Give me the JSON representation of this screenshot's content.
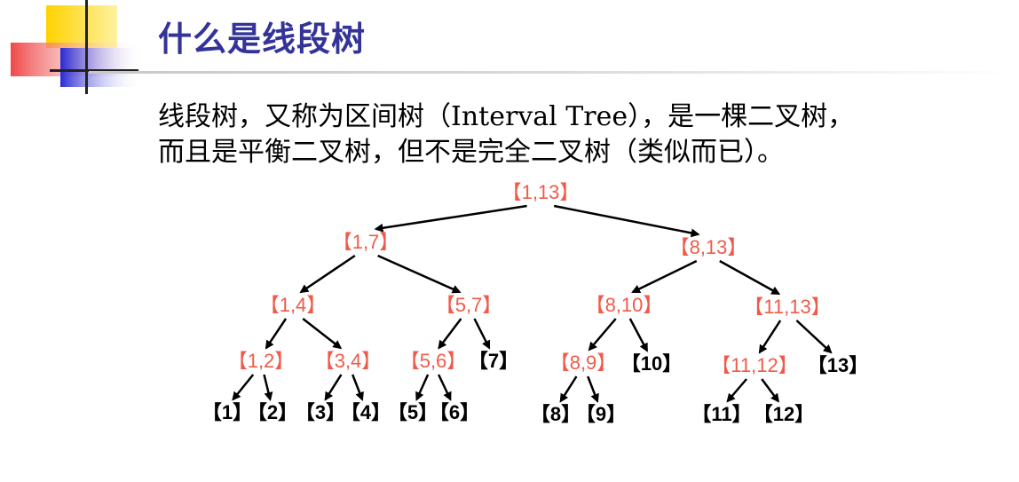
{
  "slide": {
    "title": "什么是线段树",
    "paragraph": [
      "线段树，又称为区间树（Interval Tree），是一棵二叉树，",
      "而且是平衡二叉树，但不是完全二叉树（类似而已）。"
    ]
  },
  "colors": {
    "title": "#333399",
    "internal_node": "#f05a4a",
    "leaf_node": "#000000",
    "edge": "#000000",
    "accent_yellow": "#ffd200",
    "accent_blue": "#2a2ad4",
    "accent_red": "#f04848"
  },
  "tree": {
    "nodes": [
      {
        "id": "n1_13",
        "label": "【1,13】",
        "type": "internal"
      },
      {
        "id": "n1_7",
        "label": "【1,7】",
        "type": "internal"
      },
      {
        "id": "n8_13",
        "label": "【8,13】",
        "type": "internal"
      },
      {
        "id": "n1_4",
        "label": "【1,4】",
        "type": "internal"
      },
      {
        "id": "n5_7",
        "label": "【5,7】",
        "type": "internal"
      },
      {
        "id": "n8_10",
        "label": "【8,10】",
        "type": "internal"
      },
      {
        "id": "n11_13",
        "label": "【11,13】",
        "type": "internal"
      },
      {
        "id": "n1_2",
        "label": "【1,2】",
        "type": "internal"
      },
      {
        "id": "n3_4",
        "label": "【3,4】",
        "type": "internal"
      },
      {
        "id": "n5_6",
        "label": "【5,6】",
        "type": "internal"
      },
      {
        "id": "n7",
        "label": "【7】",
        "type": "leaf"
      },
      {
        "id": "n8_9",
        "label": "【8,9】",
        "type": "internal"
      },
      {
        "id": "n10",
        "label": "【10】",
        "type": "leaf"
      },
      {
        "id": "n11_12",
        "label": "【11,12】",
        "type": "internal"
      },
      {
        "id": "n13",
        "label": "【13】",
        "type": "leaf"
      },
      {
        "id": "n1",
        "label": "【1】",
        "type": "leaf"
      },
      {
        "id": "n2",
        "label": "【2】",
        "type": "leaf"
      },
      {
        "id": "n3",
        "label": "【3】",
        "type": "leaf"
      },
      {
        "id": "n4",
        "label": "【4】",
        "type": "leaf"
      },
      {
        "id": "n5",
        "label": "【5】",
        "type": "leaf"
      },
      {
        "id": "n6",
        "label": "【6】",
        "type": "leaf"
      },
      {
        "id": "n8",
        "label": "【8】",
        "type": "leaf"
      },
      {
        "id": "n9",
        "label": "【9】",
        "type": "leaf"
      },
      {
        "id": "n11",
        "label": "【11】",
        "type": "leaf"
      },
      {
        "id": "n12",
        "label": "【12】",
        "type": "leaf"
      }
    ],
    "edges": [
      [
        "n1_13",
        "n1_7"
      ],
      [
        "n1_13",
        "n8_13"
      ],
      [
        "n1_7",
        "n1_4"
      ],
      [
        "n1_7",
        "n5_7"
      ],
      [
        "n8_13",
        "n8_10"
      ],
      [
        "n8_13",
        "n11_13"
      ],
      [
        "n1_4",
        "n1_2"
      ],
      [
        "n1_4",
        "n3_4"
      ],
      [
        "n5_7",
        "n5_6"
      ],
      [
        "n5_7",
        "n7"
      ],
      [
        "n8_10",
        "n8_9"
      ],
      [
        "n8_10",
        "n10"
      ],
      [
        "n11_13",
        "n11_12"
      ],
      [
        "n11_13",
        "n13"
      ],
      [
        "n1_2",
        "n1"
      ],
      [
        "n1_2",
        "n2"
      ],
      [
        "n3_4",
        "n3"
      ],
      [
        "n3_4",
        "n4"
      ],
      [
        "n5_6",
        "n5"
      ],
      [
        "n5_6",
        "n6"
      ],
      [
        "n8_9",
        "n8"
      ],
      [
        "n8_9",
        "n9"
      ],
      [
        "n11_12",
        "n11"
      ],
      [
        "n11_12",
        "n12"
      ]
    ]
  }
}
